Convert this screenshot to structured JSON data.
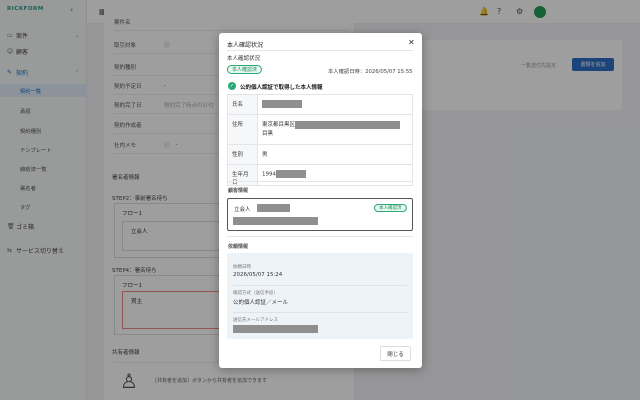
{
  "brand": {
    "logo": "RICKFORM"
  },
  "sidebar": {
    "items": [
      {
        "label": "案件"
      },
      {
        "label": "顧客"
      },
      {
        "label": "契約"
      }
    ],
    "sub_items": [
      {
        "label": "契約一覧"
      },
      {
        "label": "承認"
      },
      {
        "label": "契約種別"
      },
      {
        "label": "テンプレート"
      },
      {
        "label": "締結済一覧"
      },
      {
        "label": "署名者"
      },
      {
        "label": "タグ"
      }
    ],
    "trash": "ゴミ箱",
    "service_switch": "サービス切り替え"
  },
  "background": {
    "rows": [
      {
        "label": "案件名",
        "value": ""
      },
      {
        "label": "取引対象",
        "value": ""
      },
      {
        "label": "契約種別",
        "value": ""
      },
      {
        "label": "契約予定日",
        "value": "-"
      },
      {
        "label": "契約完了日",
        "value": "契約完了時点の日付"
      },
      {
        "label": "契約作成者",
        "value": ""
      },
      {
        "label": "社内メモ",
        "value": "-"
      }
    ],
    "signer_heading": "署名者情報",
    "step2": "STEP2：事前署名待ち",
    "flow1": "フロー1",
    "witness": "立会人",
    "step4": "STEP4：署名待ち",
    "flow1b": "フロー1",
    "buyer": "買主",
    "sharer_heading": "共有者情報",
    "sharer_hint": "［共有者を追加］ボタンから共有者を追加できます",
    "unsent_label": "一覧送付先設定",
    "add_doc_button": "書類を追加"
  },
  "modal": {
    "title": "本人確認状況",
    "subtitle": "本人確認状況",
    "status_badge": "本人確認済",
    "confirmed_at": "本人確認日時：2026/05/07 15:55",
    "section_heading": "公的個人認証で取得した本人情報",
    "info": [
      {
        "label": "氏名",
        "value": ""
      },
      {
        "label": "住所",
        "value": "東京都目黒区",
        "value2": "目黒"
      },
      {
        "label": "性別",
        "value": "男"
      },
      {
        "label": "生年月日",
        "value": "1994"
      }
    ],
    "customer_heading": "顧客情報",
    "customer_role": "立会人",
    "customer_badge": "本人確認済",
    "request_heading": "依頼情報",
    "request": [
      {
        "label": "依頼日時",
        "value": "2026/05/07 15:24"
      },
      {
        "label": "確認方式（送信手段）",
        "value": "公的個人認証／メール"
      },
      {
        "label": "送信先メールアドレス",
        "value": ""
      }
    ],
    "close_button": "閉じる"
  }
}
